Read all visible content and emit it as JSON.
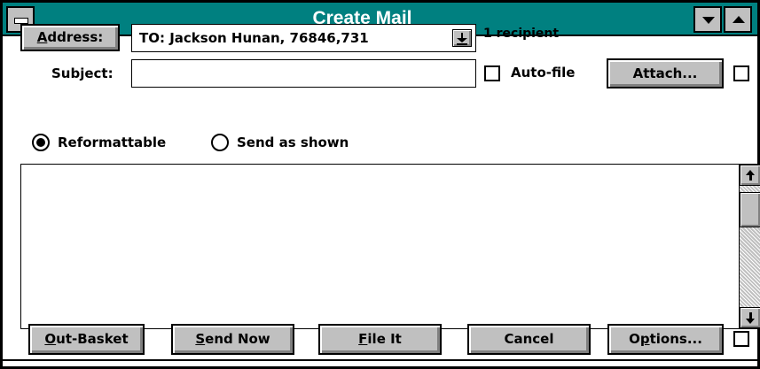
{
  "window": {
    "title": "Create Mail"
  },
  "address": {
    "button_mnemonic": "A",
    "button_rest": "ddress:",
    "to_value": "TO: Jackson Hunan, 76846,731",
    "recipient_count": "1 recipient"
  },
  "subject": {
    "label": "Subject:",
    "value": ""
  },
  "options_row": {
    "autofile_label": "Auto-file",
    "autofile_checked": false,
    "attach_label": "Attach...",
    "attach_checked": false
  },
  "format": {
    "reformattable_label": "Reformattable",
    "send_as_shown_label": "Send as shown",
    "selected": "Reformattable"
  },
  "message_body": {
    "text": ""
  },
  "buttons": {
    "out_basket_mnemonic": "O",
    "out_basket_rest": "ut-Basket",
    "send_now_mnemonic": "S",
    "send_now_rest": "end Now",
    "file_it_mnemonic": "F",
    "file_it_rest": "ile It",
    "cancel_label": "Cancel",
    "options_pre": "O",
    "options_mnemonic": "p",
    "options_rest": "tions...",
    "options_checked": false
  },
  "colors": {
    "titlebar": "#008080",
    "face": "#c0c0c0"
  }
}
